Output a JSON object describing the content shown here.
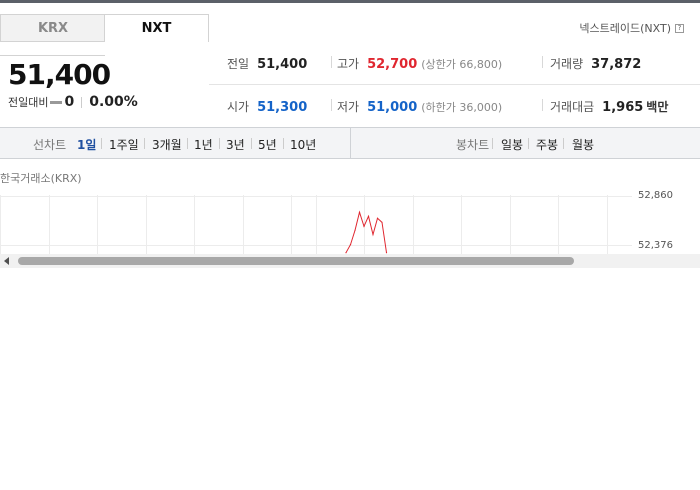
{
  "tabs": [
    {
      "label": "KRX",
      "active": false
    },
    {
      "label": "NXT",
      "active": true
    }
  ],
  "exchange_label": "넥스트레이드(NXT)",
  "info_icon": "?",
  "price": {
    "current": "51,400",
    "change_label": "전일대비",
    "change_value": "0",
    "change_percent": "0.00%"
  },
  "stats": {
    "prev_close": {
      "label": "전일",
      "value": "51,400"
    },
    "high": {
      "label": "고가",
      "value": "52,700",
      "sub": "(상한가 66,800)"
    },
    "volume": {
      "label": "거래량",
      "value": "37,872"
    },
    "open": {
      "label": "시가",
      "value": "51,300"
    },
    "low": {
      "label": "저가",
      "value": "51,000",
      "sub": "(하한가 36,000)"
    },
    "trade_amount": {
      "label": "거래대금",
      "value": "1,965",
      "unit": "백만"
    }
  },
  "line_chart_bar": {
    "title": "선차트",
    "periods": [
      "1일",
      "1주일",
      "3개월",
      "1년",
      "3년",
      "5년",
      "10년"
    ],
    "active": "1일"
  },
  "candle_bar": {
    "title": "봉차트",
    "periods": [
      "일봉",
      "주봉",
      "월봉"
    ]
  },
  "chart": {
    "market_label": "한국거래소(KRX)",
    "y_ticks": [
      "52,860",
      "52,376"
    ],
    "line_color": "#e0262f"
  },
  "chart_data": {
    "type": "line",
    "title": "",
    "ylim": [
      52376,
      52860
    ],
    "series": [
      {
        "values": [
          52300,
          52380,
          52520,
          52700,
          52560,
          52660,
          52480,
          52640,
          52600,
          52300
        ]
      }
    ]
  }
}
